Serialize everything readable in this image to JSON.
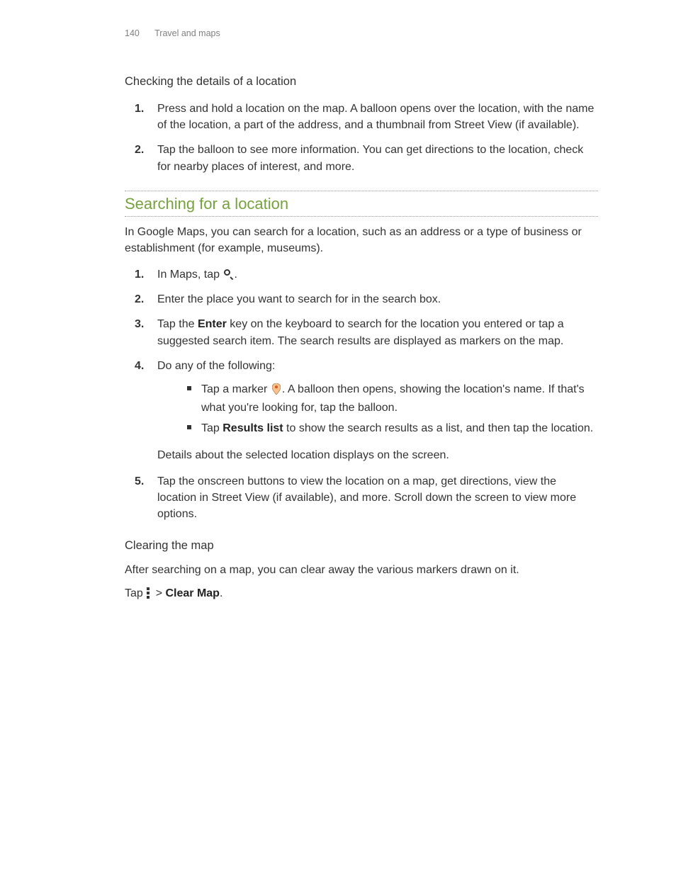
{
  "header": {
    "page_number": "140",
    "section": "Travel and maps"
  },
  "check_details": {
    "heading": "Checking the details of a location",
    "steps": [
      "Press and hold a location on the map. A balloon opens over the location, with the name of the location, a part of the address, and a thumbnail from Street View (if available).",
      "Tap the balloon to see more information. You can get directions to the location, check for nearby places of interest, and more."
    ]
  },
  "search": {
    "title": "Searching for a location",
    "intro": "In Google Maps, you can search for a location, such as an address or a type of business or establishment (for example, museums).",
    "step1_a": "In Maps, tap ",
    "step1_b": ".",
    "step2": "Enter the place you want to search for in the search box.",
    "step3_a": "Tap the ",
    "step3_enter": "Enter",
    "step3_b": " key on the keyboard to search for the location you entered or tap a suggested search item. The search results are displayed as markers on the map.",
    "step4": "Do any of the following:",
    "bullet1_a": "Tap a marker ",
    "bullet1_b": ". A balloon then opens, showing the location's name. If that's what you're looking for, tap the balloon.",
    "bullet2_a": "Tap ",
    "bullet2_bold": "Results list",
    "bullet2_b": " to show the search results as a list, and then tap the location.",
    "details_note": "Details about the selected location displays on the screen.",
    "step5": "Tap the onscreen buttons to view the location on a map, get directions, view the location in Street View (if available), and more. Scroll down the screen to view more options."
  },
  "clear": {
    "heading": "Clearing the map",
    "intro": "After searching on a map, you can clear away the various markers drawn on it.",
    "tap_a": "Tap ",
    "tap_gt": " > ",
    "tap_bold": "Clear Map",
    "tap_b": "."
  }
}
